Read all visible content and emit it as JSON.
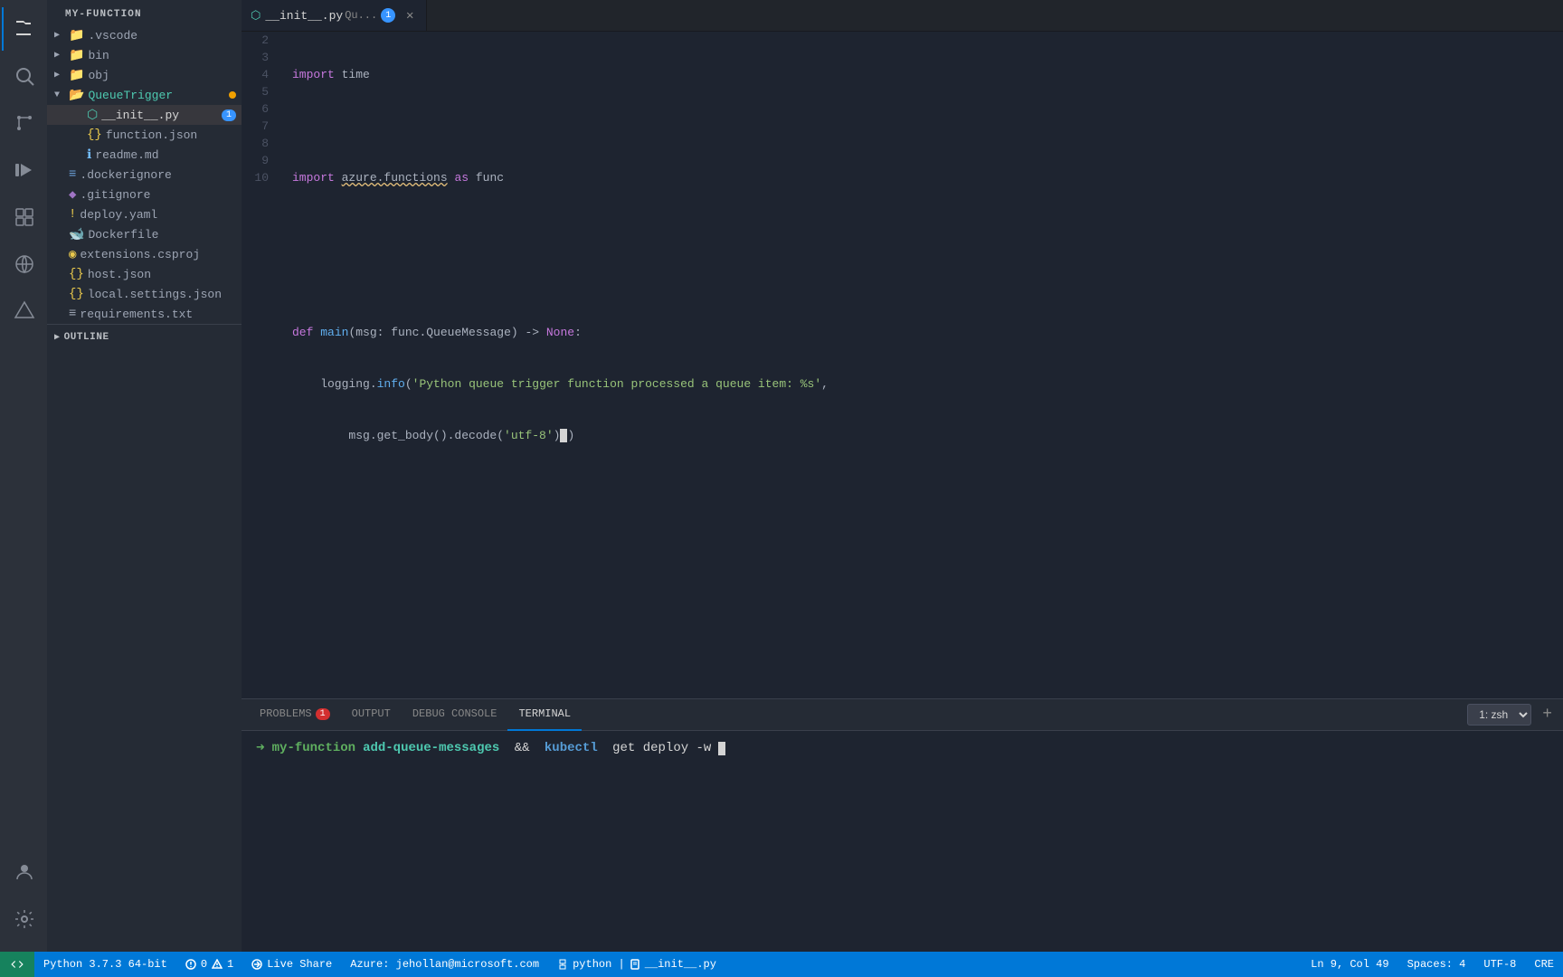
{
  "activity": {
    "icons": [
      {
        "name": "search-icon",
        "symbol": "🔍",
        "active": false
      },
      {
        "name": "files-icon",
        "symbol": "📋",
        "active": true
      },
      {
        "name": "source-control-icon",
        "symbol": "⑂",
        "active": false
      },
      {
        "name": "debug-icon",
        "symbol": "🐛",
        "active": false
      },
      {
        "name": "extensions-icon",
        "symbol": "⊞",
        "active": false
      },
      {
        "name": "remote-icon",
        "symbol": "🌐",
        "active": false
      },
      {
        "name": "azure-icon",
        "symbol": "△",
        "active": false
      }
    ],
    "bottom_icons": [
      {
        "name": "account-icon",
        "symbol": "◉"
      },
      {
        "name": "settings-icon",
        "symbol": "⚙"
      }
    ]
  },
  "sidebar": {
    "title": "MY-FUNCTION",
    "items": [
      {
        "label": ".vscode",
        "type": "folder",
        "indent": 0,
        "collapsed": true
      },
      {
        "label": "bin",
        "type": "folder",
        "indent": 0,
        "collapsed": true
      },
      {
        "label": "obj",
        "type": "folder",
        "indent": 0,
        "collapsed": true
      },
      {
        "label": "QueueTrigger",
        "type": "folder-open",
        "indent": 0,
        "collapsed": false,
        "modified": true
      },
      {
        "label": "__init__.py",
        "type": "python",
        "indent": 1,
        "selected": true,
        "badge": 1
      },
      {
        "label": "function.json",
        "type": "json",
        "indent": 1
      },
      {
        "label": "readme.md",
        "type": "info",
        "indent": 1
      },
      {
        "label": ".dockerignore",
        "type": "file",
        "indent": 0
      },
      {
        "label": ".gitignore",
        "type": "diamond",
        "indent": 0
      },
      {
        "label": "deploy.yaml",
        "type": "warning",
        "indent": 0
      },
      {
        "label": "Dockerfile",
        "type": "docker",
        "indent": 0
      },
      {
        "label": "extensions.csproj",
        "type": "rss",
        "indent": 0
      },
      {
        "label": "host.json",
        "type": "braces",
        "indent": 0
      },
      {
        "label": "local.settings.json",
        "type": "braces",
        "indent": 0
      },
      {
        "label": "requirements.txt",
        "type": "list",
        "indent": 0
      }
    ],
    "outline": {
      "label": "OUTLINE"
    }
  },
  "tabs": [
    {
      "label": "__init__.py",
      "subtitle": "Qu...",
      "active": true,
      "badge": 1,
      "modified": false,
      "close": true
    },
    {
      "label": "1",
      "active": false
    }
  ],
  "code": {
    "lines": [
      {
        "num": 2,
        "content": "import time",
        "tokens": [
          {
            "type": "kw",
            "text": "import"
          },
          {
            "type": "plain",
            "text": " time"
          }
        ]
      },
      {
        "num": 3,
        "content": "",
        "tokens": []
      },
      {
        "num": 4,
        "content": "import azure.functions as func",
        "tokens": [
          {
            "type": "kw",
            "text": "import"
          },
          {
            "type": "plain",
            "text": " "
          },
          {
            "type": "squiggly",
            "text": "azure.functions"
          },
          {
            "type": "plain",
            "text": " "
          },
          {
            "type": "kw",
            "text": "as"
          },
          {
            "type": "plain",
            "text": " func"
          }
        ]
      },
      {
        "num": 5,
        "content": "",
        "tokens": []
      },
      {
        "num": 6,
        "content": "",
        "tokens": []
      },
      {
        "num": 7,
        "content": "def main(msg: func.QueueMessage) -> None:",
        "tokens": [
          {
            "type": "kw",
            "text": "def"
          },
          {
            "type": "plain",
            "text": " "
          },
          {
            "type": "fn",
            "text": "main"
          },
          {
            "type": "plain",
            "text": "(msg: func.QueueMessage) -> "
          },
          {
            "type": "none",
            "text": "None"
          },
          {
            "type": "plain",
            "text": ":"
          }
        ]
      },
      {
        "num": 8,
        "content": "    logging.info('Python queue trigger function processed a queue item: %s',",
        "tokens": [
          {
            "type": "plain",
            "text": "    logging."
          },
          {
            "type": "fn",
            "text": "info"
          },
          {
            "type": "plain",
            "text": "("
          },
          {
            "type": "str",
            "text": "'Python queue trigger function processed a queue item: %s'"
          },
          {
            "type": "plain",
            "text": ","
          }
        ]
      },
      {
        "num": 9,
        "content": "        msg.get_body().decode('utf-8'))",
        "tokens": [
          {
            "type": "plain",
            "text": "        msg.get_body().decode("
          },
          {
            "type": "str",
            "text": "'utf-8'"
          },
          {
            "type": "plain",
            "text": ")"
          },
          {
            "type": "cursor",
            "text": ")"
          }
        ]
      },
      {
        "num": 10,
        "content": "",
        "tokens": []
      }
    ]
  },
  "panel": {
    "tabs": [
      {
        "label": "PROBLEMS",
        "active": false,
        "badge": 1
      },
      {
        "label": "OUTPUT",
        "active": false
      },
      {
        "label": "DEBUG CONSOLE",
        "active": false
      },
      {
        "label": "TERMINAL",
        "active": true
      }
    ],
    "terminal_selector": "1: zsh",
    "terminal_add": "+",
    "terminal": {
      "prompt_arrow": "➜",
      "function_name": "my-function",
      "command": "add-queue-messages",
      "operator": "&&",
      "kubectl": "kubectl",
      "subcommand": "get deploy",
      "flag": "-w"
    }
  },
  "statusbar": {
    "left": [
      {
        "icon": "remote",
        "label": ""
      },
      {
        "icon": "git",
        "label": "Python 3.7.3 64-bit"
      },
      {
        "icon": "error",
        "label": "0"
      },
      {
        "icon": "warning",
        "label": "1"
      },
      {
        "icon": "liveshare",
        "label": "Live Share"
      },
      {
        "icon": "azure",
        "label": "Azure: jehollan@microsoft.com"
      },
      {
        "icon": "python",
        "label": "python | "
      },
      {
        "icon": "file",
        "label": "__init__.py"
      }
    ],
    "right": [
      {
        "label": "Ln 9, Col 49"
      },
      {
        "label": "Spaces: 4"
      },
      {
        "label": "UTF-8"
      },
      {
        "label": "CRE"
      }
    ]
  }
}
